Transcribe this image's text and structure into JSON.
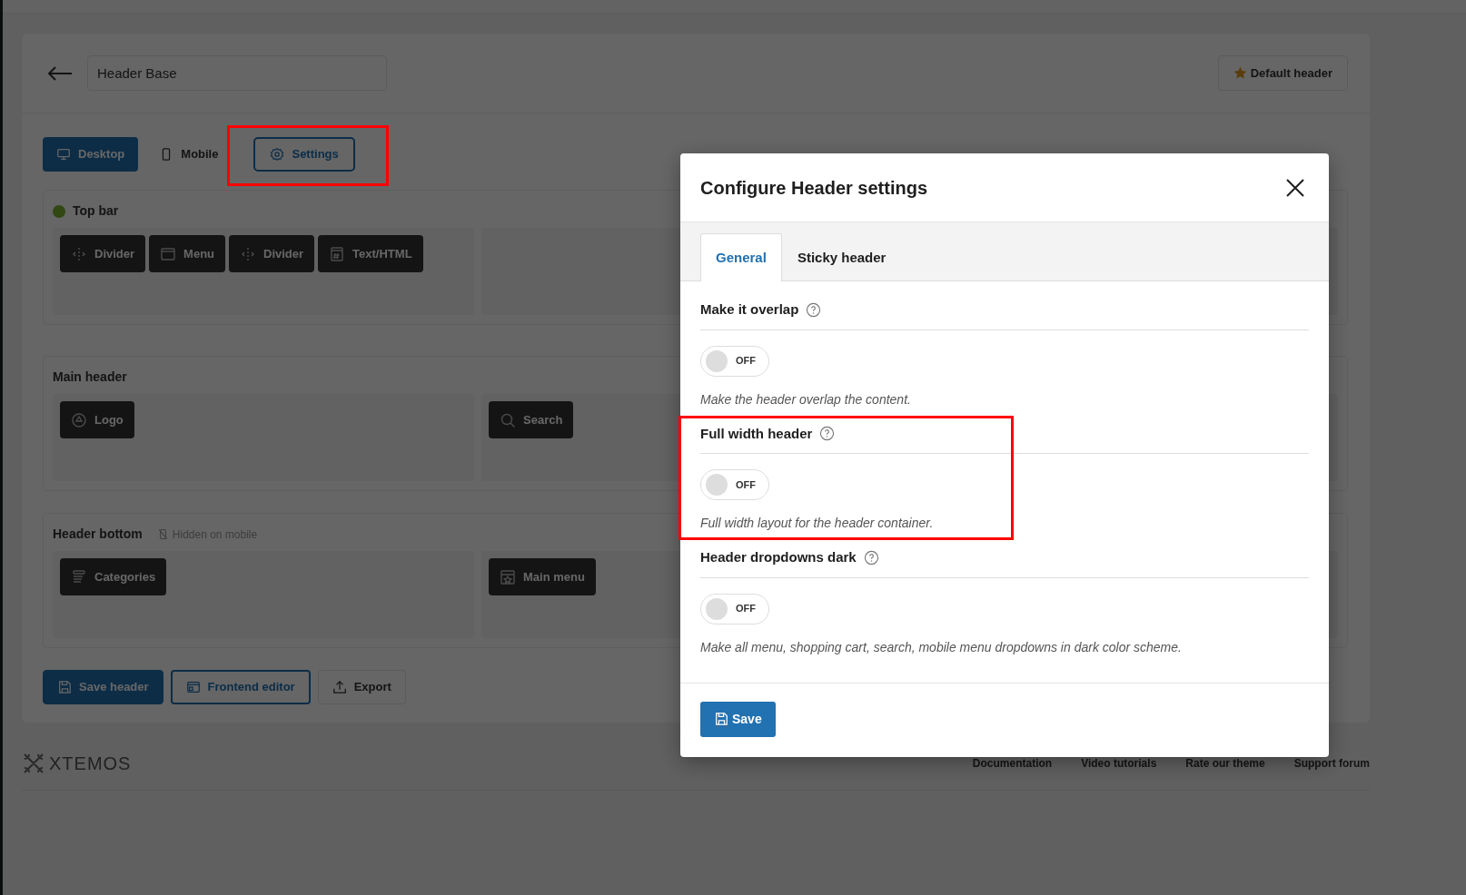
{
  "header_name": {
    "value": "Header Base"
  },
  "default_header": "Default header",
  "view_tabs": [
    {
      "label": "Desktop",
      "kind": "desktop",
      "selected": true
    },
    {
      "label": "Mobile",
      "kind": "mobile",
      "selected": false
    }
  ],
  "settings_button": "Settings",
  "rows": [
    {
      "title": "Top bar",
      "indicator": true,
      "zones": [
        [
          {
            "label": "Divider",
            "kind": "divider"
          },
          {
            "label": "Menu",
            "kind": "menu"
          },
          {
            "label": "Divider",
            "kind": "divider"
          },
          {
            "label": "Text/HTML",
            "kind": "html"
          }
        ]
      ]
    },
    {
      "title": "Main header",
      "indicator": false,
      "zones": [
        [
          {
            "label": "Logo",
            "kind": "logo"
          }
        ],
        [
          {
            "label": "Search",
            "kind": "search"
          }
        ]
      ]
    },
    {
      "title": "Header bottom",
      "indicator": false,
      "note": "Hidden on mobile",
      "zones": [
        [
          {
            "label": "Categories",
            "kind": "categories"
          }
        ],
        [
          {
            "label": "Main menu",
            "kind": "mainmenu"
          }
        ]
      ]
    }
  ],
  "actions": [
    {
      "label": "Save header",
      "kind": "primary"
    },
    {
      "label": "Frontend editor",
      "kind": "outline"
    },
    {
      "label": "Export",
      "kind": "plain"
    }
  ],
  "footer": {
    "brand": "XTEMOS",
    "links": [
      "Documentation",
      "Video tutorials",
      "Rate our theme",
      "Support forum"
    ]
  },
  "modal": {
    "title": "Configure Header settings",
    "tabs": [
      {
        "label": "General",
        "selected": true
      },
      {
        "label": "Sticky header",
        "selected": false
      }
    ],
    "settings": [
      {
        "label": "Make it overlap",
        "on": false,
        "state_label": "OFF",
        "description": "Make the header overlap the content."
      },
      {
        "label": "Full width header",
        "on": false,
        "state_label": "OFF",
        "description": "Full width layout for the header container."
      },
      {
        "label": "Header dropdowns dark",
        "on": false,
        "state_label": "OFF",
        "description": "Make all menu, shopping cart, search, mobile menu dropdowns in dark color scheme."
      }
    ],
    "save": "Save"
  }
}
